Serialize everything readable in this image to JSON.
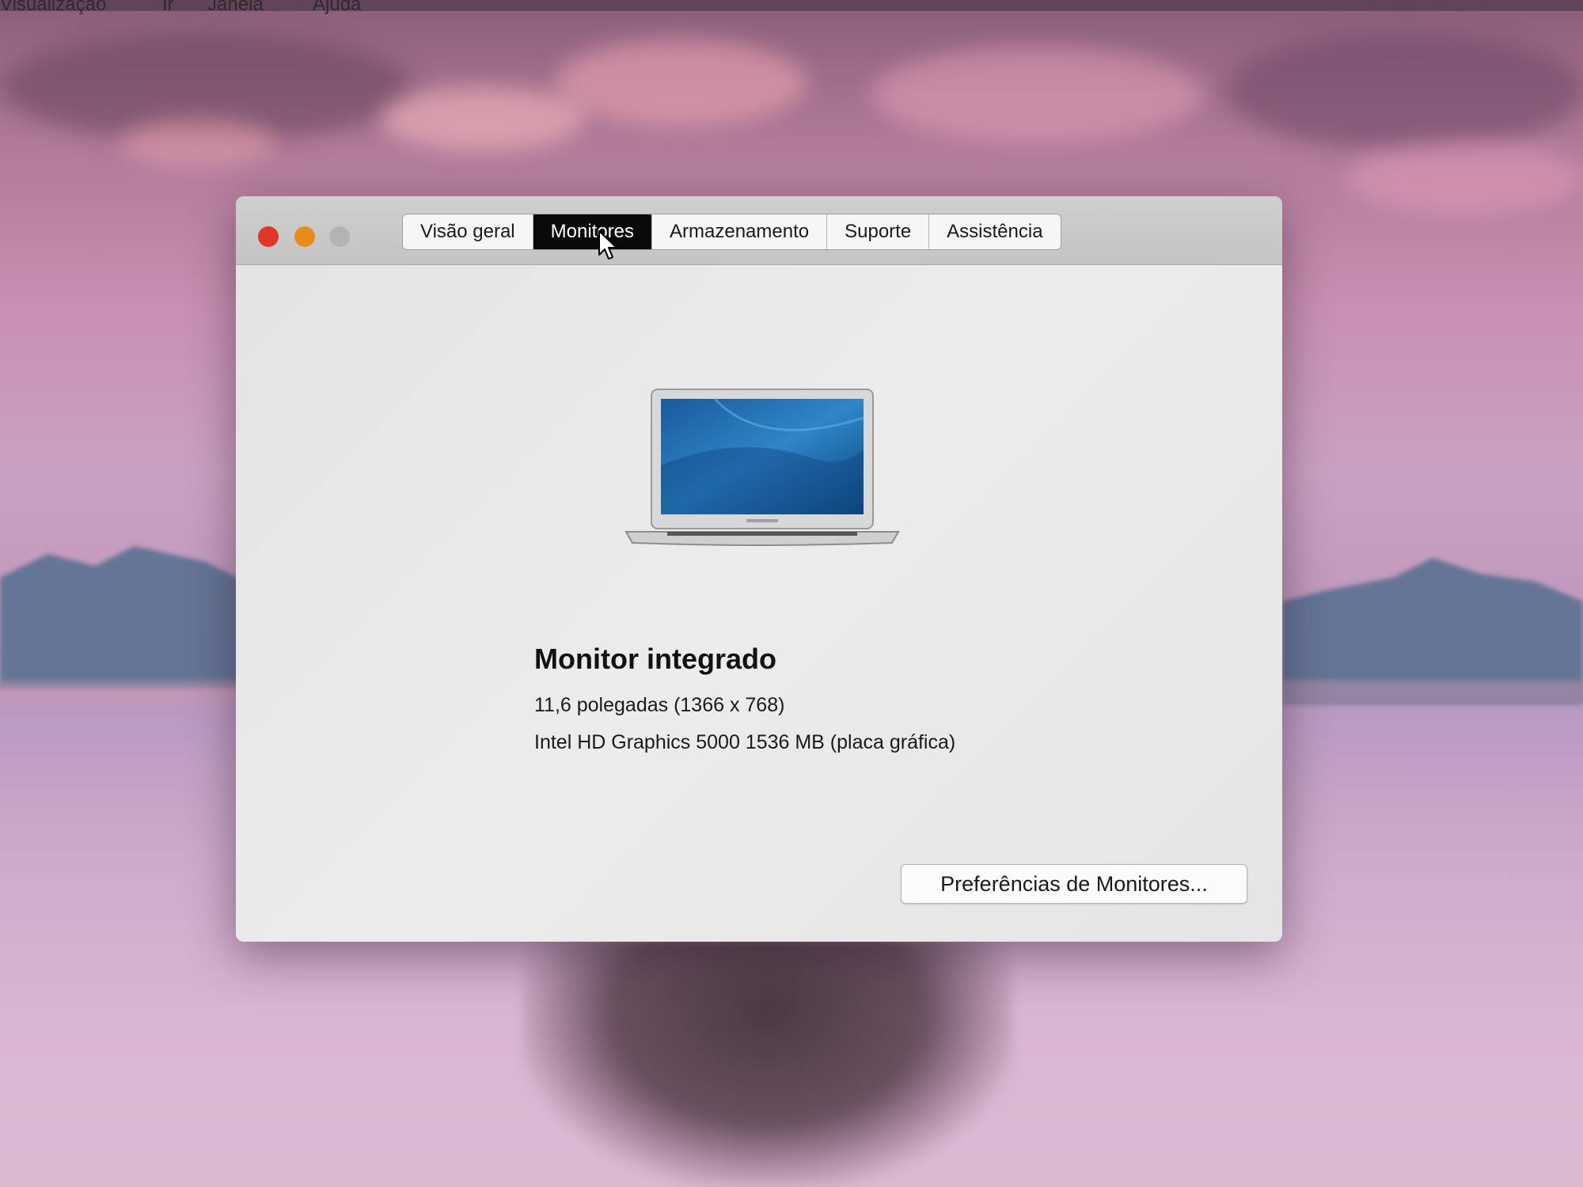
{
  "menubar": {
    "items": [
      "Visualização",
      "Ir",
      "Janela",
      "Ajuda"
    ]
  },
  "window": {
    "tabs": [
      {
        "label": "Visão geral",
        "active": false
      },
      {
        "label": "Monitores",
        "active": true
      },
      {
        "label": "Armazenamento",
        "active": false
      },
      {
        "label": "Suporte",
        "active": false
      },
      {
        "label": "Assistência",
        "active": false
      }
    ],
    "display": {
      "title": "Monitor integrado",
      "size_resolution": "11,6 polegadas (1366 x 768)",
      "graphics": "Intel HD Graphics 5000 1536 MB (placa gráfica)"
    },
    "preferences_button": "Preferências de Monitores..."
  },
  "colors": {
    "close": "#e0352a",
    "minimize": "#e88c1d",
    "zoom_inactive": "#b4b4b4",
    "active_tab": "#0a0a0a"
  },
  "icons": [
    "close-icon",
    "minimize-icon",
    "zoom-icon",
    "pointer-cursor-icon",
    "macbook-air-icon"
  ]
}
